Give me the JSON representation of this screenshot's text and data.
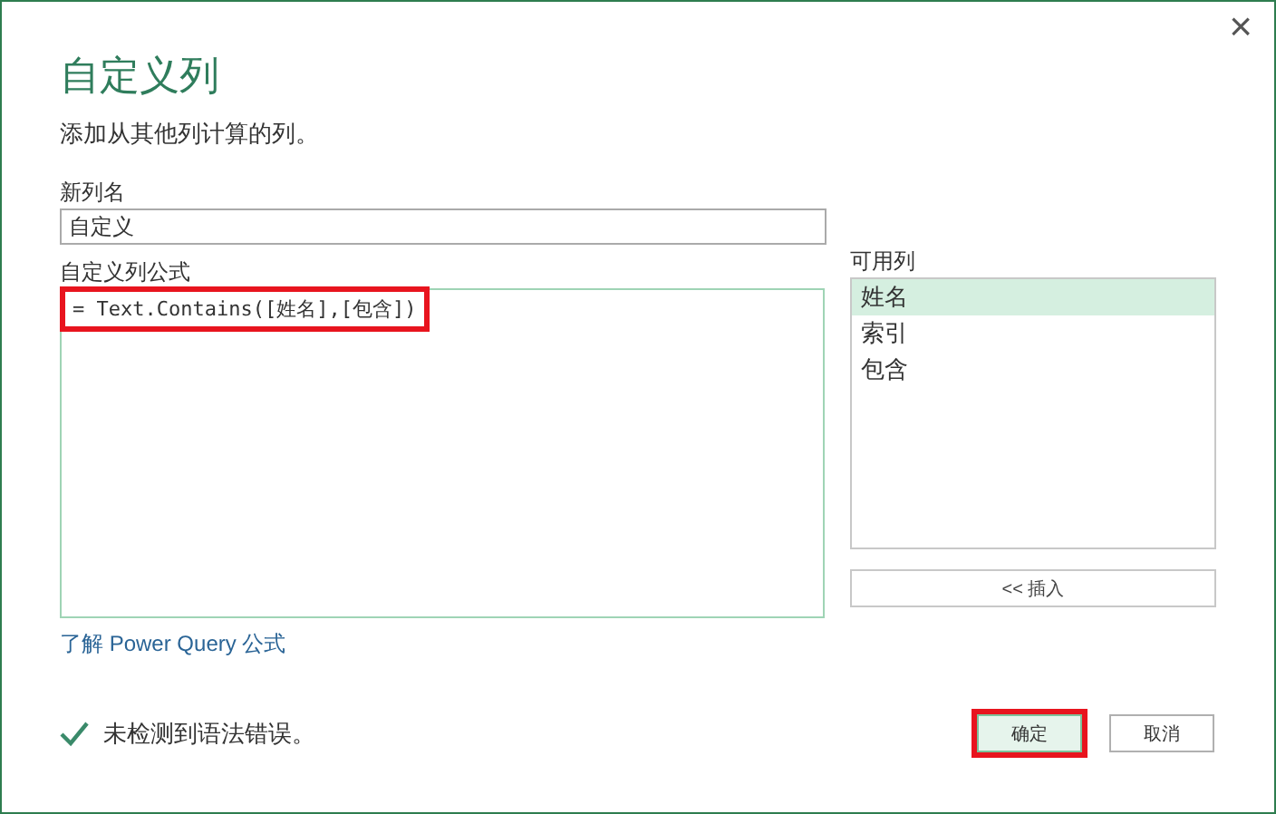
{
  "dialog": {
    "title": "自定义列",
    "subtitle": "添加从其他列计算的列。",
    "close_icon": "×"
  },
  "new_column_name": {
    "label": "新列名",
    "value": "自定义"
  },
  "formula": {
    "label": "自定义列公式",
    "value": "= Text.Contains([姓名],[包含])",
    "highlighted": true
  },
  "available_columns": {
    "label": "可用列",
    "items": [
      {
        "label": "姓名",
        "selected": true
      },
      {
        "label": "索引",
        "selected": false
      },
      {
        "label": "包含",
        "selected": false
      }
    ],
    "insert_button": "<< 插入"
  },
  "learn_link": "了解 Power Query 公式",
  "status": {
    "ok": true,
    "text": "未检测到语法错误。"
  },
  "buttons": [
    {
      "label": "确定",
      "primary": true,
      "highlighted": true
    },
    {
      "label": "取消",
      "primary": false,
      "highlighted": false
    }
  ]
}
